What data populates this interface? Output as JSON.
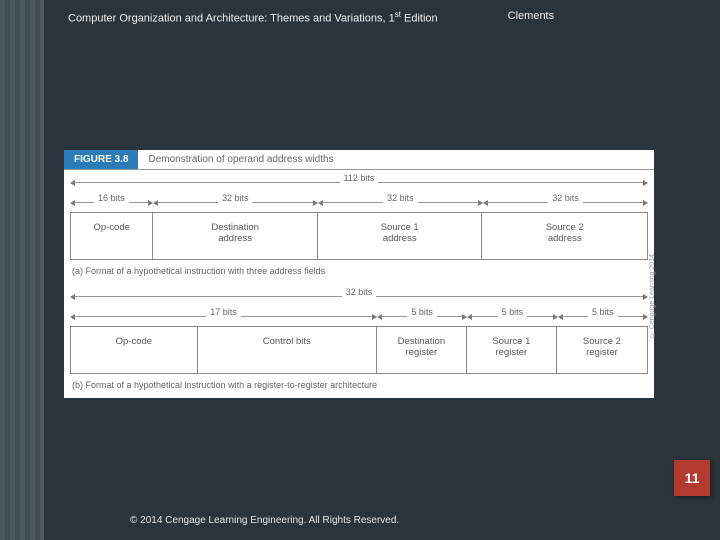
{
  "header": {
    "title_prefix": "Computer Organization and Architecture: Themes and Variations, 1",
    "title_suffix": " Edition",
    "superscript": "st",
    "author": "Clements"
  },
  "figure": {
    "badge": "FIGURE 3.8",
    "caption": "Demonstration of operand address widths",
    "side_credit": "© Cengage Learning 2014"
  },
  "partA": {
    "total_width": "112 bits",
    "widths": [
      "16 bits",
      "32 bits",
      "32 bits",
      "32 bits"
    ],
    "cells": [
      "Op-code",
      "Destination\naddress",
      "Source 1\naddress",
      "Source 2\naddress"
    ],
    "sub_caption": "(a) Format of a hypothetical instruction with three address fields"
  },
  "partB": {
    "total_width": "32 bits",
    "widths": [
      "17 bits",
      "5 bits",
      "5 bits",
      "5 bits"
    ],
    "cells": [
      "Op-code",
      "Control bits",
      "Destination\nregister",
      "Source 1\nregister",
      "Source 2\nregister"
    ],
    "sub_caption": "(b) Format of a hypothetical instruction with a register-to-register architecture"
  },
  "page_number": "11",
  "footer": "© 2014 Cengage Learning Engineering. All Rights Reserved."
}
